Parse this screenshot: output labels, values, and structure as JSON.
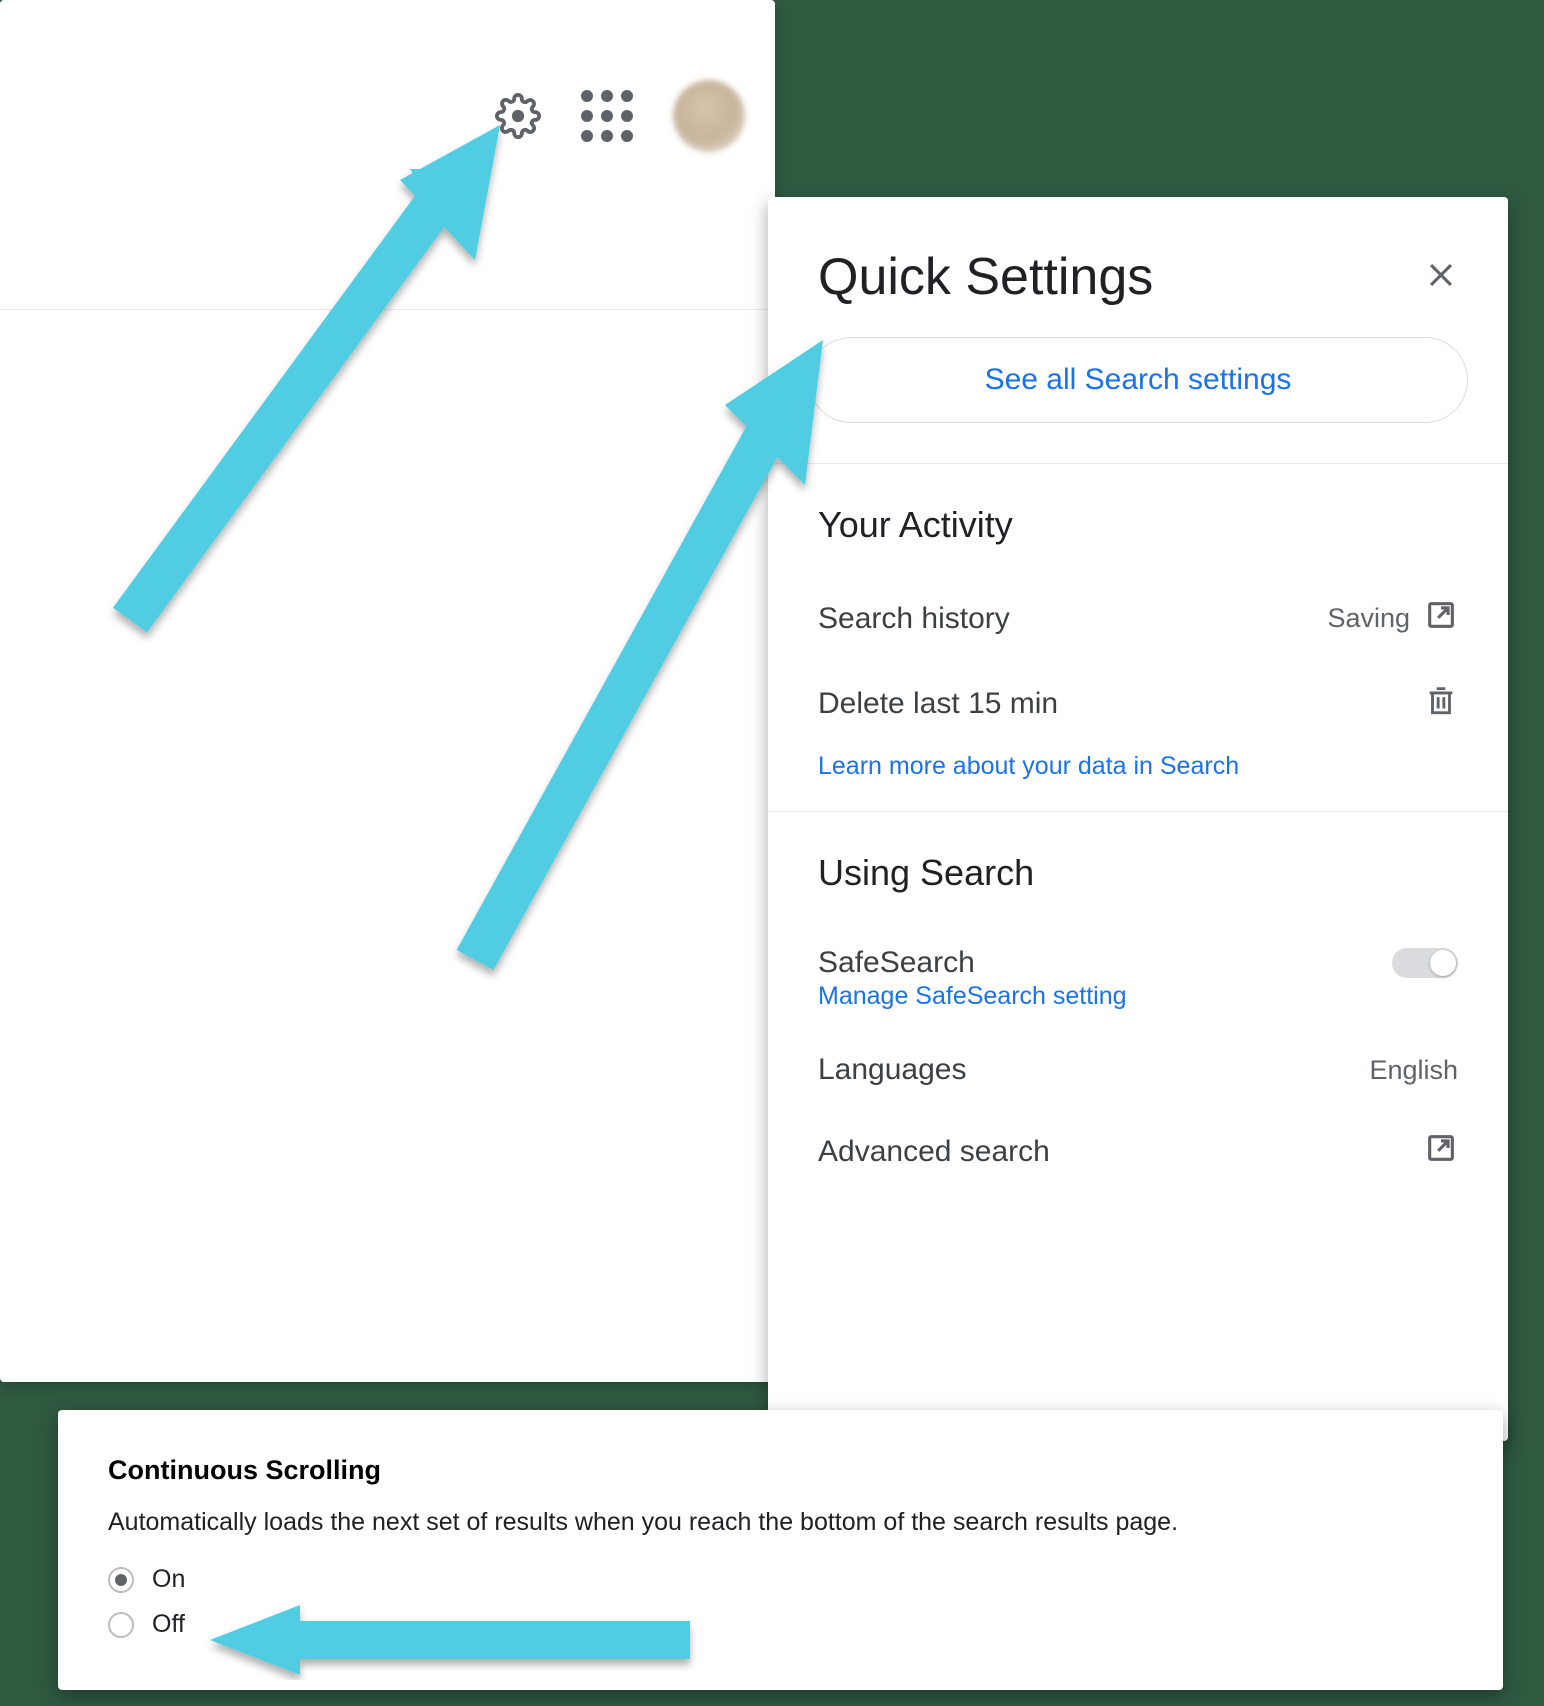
{
  "quick_settings": {
    "title": "Quick Settings",
    "see_all": "See all Search settings",
    "activity": {
      "heading": "Your Activity",
      "search_history_label": "Search history",
      "search_history_status": "Saving",
      "delete_last_label": "Delete last 15 min",
      "learn_more": "Learn more about your data in Search"
    },
    "using_search": {
      "heading": "Using Search",
      "safesearch_label": "SafeSearch",
      "safesearch_manage": "Manage SafeSearch setting",
      "languages_label": "Languages",
      "languages_value": "English",
      "advanced_label": "Advanced search"
    }
  },
  "continuous_scrolling": {
    "title": "Continuous Scrolling",
    "description": "Automatically loads the next set of results when you reach the bottom of the search results page.",
    "option_on": "On",
    "option_off": "Off",
    "selected": "On"
  }
}
